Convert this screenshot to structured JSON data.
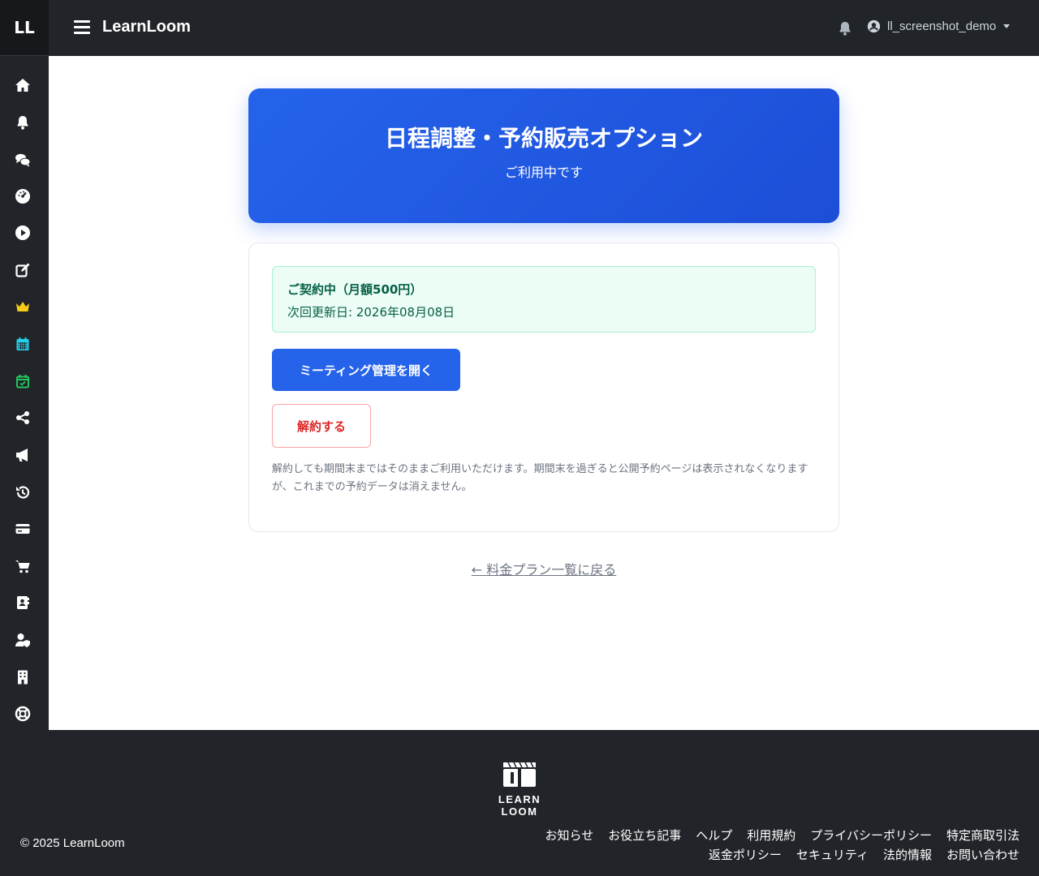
{
  "header": {
    "brand_short": "LL",
    "app_title": "LearnLoom",
    "username": "ll_screenshot_demo"
  },
  "sidebar": {
    "items": [
      {
        "icon": "home-icon",
        "color": "#ffffff"
      },
      {
        "icon": "bell-icon",
        "color": "#ffffff"
      },
      {
        "icon": "chat-icon",
        "color": "#ffffff"
      },
      {
        "icon": "dashboard-icon",
        "color": "#ffffff"
      },
      {
        "icon": "play-icon",
        "color": "#ffffff"
      },
      {
        "icon": "edit-icon",
        "color": "#ffffff"
      },
      {
        "icon": "crown-icon",
        "color": "#facc15"
      },
      {
        "icon": "calendar-icon",
        "color": "#22d3ee"
      },
      {
        "icon": "calendar-check-icon",
        "color": "#22c55e"
      },
      {
        "icon": "share-icon",
        "color": "#ffffff"
      },
      {
        "icon": "megaphone-icon",
        "color": "#ffffff"
      },
      {
        "icon": "history-icon",
        "color": "#ffffff"
      },
      {
        "icon": "credit-card-icon",
        "color": "#ffffff"
      },
      {
        "icon": "cart-icon",
        "color": "#ffffff"
      },
      {
        "icon": "address-book-icon",
        "color": "#ffffff"
      },
      {
        "icon": "user-shield-icon",
        "color": "#ffffff"
      },
      {
        "icon": "building-icon",
        "color": "#ffffff"
      },
      {
        "icon": "lifebuoy-icon",
        "color": "#ffffff"
      }
    ]
  },
  "hero": {
    "title": "日程調整・予約販売オプション",
    "subtitle": "ご利用中です"
  },
  "subscription": {
    "status": "ご契約中（月額500円）",
    "next_renewal": "次回更新日: 2026年08月08日",
    "open_button": "ミーティング管理を開く",
    "cancel_button": "解約する",
    "note": "解約しても期間末まではそのままご利用いただけます。期間末を過ぎると公開予約ページは表示されなくなりますが、これまでの予約データは消えません。"
  },
  "back_link": "← 料金プラン一覧に戻る",
  "footer": {
    "logo_text": "LEARN LOOM",
    "copyright": "© 2025 LearnLoom",
    "links": [
      "お知らせ",
      "お役立ち記事",
      "ヘルプ",
      "利用規約",
      "プライバシーポリシー",
      "特定商取引法",
      "返金ポリシー",
      "セキュリティ",
      "法的情報",
      "お問い合わせ"
    ]
  },
  "colors": {
    "primary": "#2563eb",
    "danger": "#dc2626",
    "success_bg": "#ecfdf5",
    "success_text": "#065f46",
    "dark": "#212529"
  }
}
